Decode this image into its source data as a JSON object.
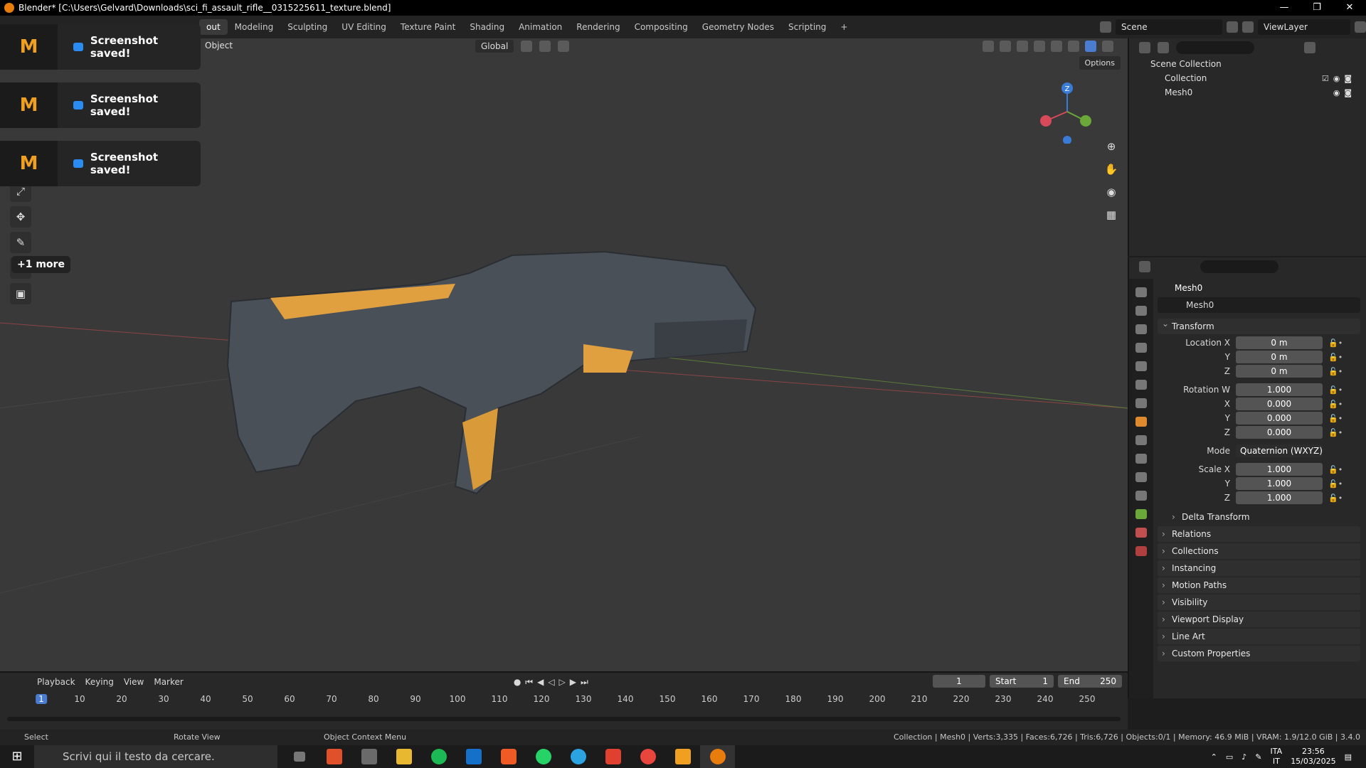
{
  "window": {
    "title": "Blender* [C:\\Users\\Gelvard\\Downloads\\sci_fi_assault_rifle__0315225611_texture.blend]",
    "minimize": "—",
    "restore": "❐",
    "close": "✕"
  },
  "workspaces": [
    "out",
    "Modeling",
    "Sculpting",
    "UV Editing",
    "Texture Paint",
    "Shading",
    "Animation",
    "Rendering",
    "Compositing",
    "Geometry Nodes",
    "Scripting",
    "+"
  ],
  "scene": {
    "name": "Scene",
    "view_layer": "ViewLayer"
  },
  "viewport": {
    "mode_label": "Object",
    "orientation": "Global",
    "options_label": "Options",
    "more_tools": "+1 more",
    "gizmo_axes": [
      "Z",
      "X",
      "Y"
    ]
  },
  "toasts": [
    {
      "brand": "M",
      "message": "Screenshot saved!"
    },
    {
      "brand": "M",
      "message": "Screenshot saved!"
    },
    {
      "brand": "M",
      "message": "Screenshot saved!"
    }
  ],
  "outliner": {
    "rows": [
      {
        "label": "Scene Collection"
      },
      {
        "label": "Collection"
      },
      {
        "label": "Mesh0"
      }
    ]
  },
  "properties": {
    "object_name": "Mesh0",
    "data_name": "Mesh0",
    "transform_label": "Transform",
    "location": {
      "label": "Location X",
      "x": "0 m",
      "y": "0 m",
      "z": "0 m"
    },
    "rotation": {
      "label": "Rotation W",
      "w": "1.000",
      "x": "0.000",
      "y": "0.000",
      "z": "0.000"
    },
    "mode": {
      "label": "Mode",
      "value": "Quaternion (WXYZ)"
    },
    "scale": {
      "label": "Scale X",
      "x": "1.000",
      "y": "1.000",
      "z": "1.000"
    },
    "axis_y": "Y",
    "axis_z": "Z",
    "axis_x": "X",
    "sections": [
      "Delta Transform",
      "Relations",
      "Collections",
      "Instancing",
      "Motion Paths",
      "Visibility",
      "Viewport Display",
      "Line Art",
      "Custom Properties"
    ]
  },
  "timeline": {
    "menus": [
      "Playback",
      "Keying",
      "View",
      "Marker"
    ],
    "current_frame": "1",
    "start_label": "Start",
    "start": "1",
    "end_label": "End",
    "end": "250",
    "ticks": [
      "1",
      "10",
      "20",
      "30",
      "40",
      "50",
      "60",
      "70",
      "80",
      "90",
      "100",
      "110",
      "120",
      "130",
      "140",
      "150",
      "160",
      "170",
      "180",
      "190",
      "200",
      "210",
      "220",
      "230",
      "240",
      "250"
    ]
  },
  "statusbar": {
    "select": "Select",
    "rotate": "Rotate View",
    "context": "Object Context Menu",
    "stats": "Collection | Mesh0 | Verts:3,335 | Faces:6,726 | Tris:6,726 | Objects:0/1 | Memory: 46.9 MiB | VRAM: 1.9/12.0 GiB | 3.4.0"
  },
  "taskbar": {
    "search_placeholder": "Scrivi qui il testo da cercare.",
    "lang": "ITA",
    "lang_sub": "IT",
    "time": "23:56",
    "date": "15/03/2025"
  },
  "colors": {
    "accent": "#4a7dd0",
    "blender_orange": "#e87d0d",
    "rifle_orange": "#e0a040",
    "rifle_body": "#4a5058"
  }
}
